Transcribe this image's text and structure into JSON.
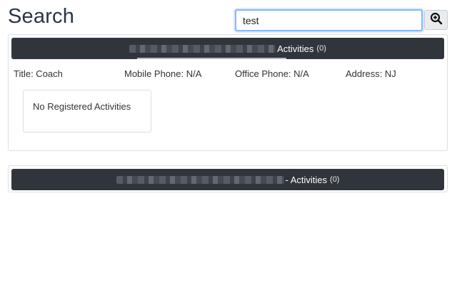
{
  "page": {
    "title": "Search"
  },
  "search": {
    "value": "test",
    "button_icon": "zoom-in-magnifier-icon"
  },
  "results": [
    {
      "header": {
        "name_redacted": true,
        "suffix": "Activities",
        "count": "(0)"
      },
      "info": {
        "title": "Title: Coach",
        "mobile_phone": "Mobile Phone: N/A",
        "office_phone": "Office Phone: N/A",
        "address": "Address: NJ"
      },
      "activities_message": "No Registered Activities"
    },
    {
      "header": {
        "name_redacted": true,
        "suffix": "- Activities",
        "count": "(0)"
      }
    }
  ],
  "colors": {
    "title": "#2b3544",
    "header_bg": "#30353c",
    "input_focus_border": "#86b7fe",
    "card_border": "#dcdfe3"
  }
}
